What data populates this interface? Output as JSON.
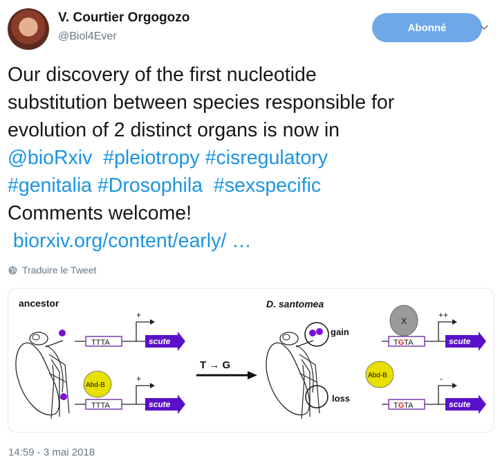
{
  "author": {
    "display_name": "V. Courtier Orgogozo",
    "handle": "@Biol4Ever"
  },
  "follow_button": {
    "label": "Abonné"
  },
  "tweet": {
    "line1": "Our discovery of the first nucleotide",
    "line2": "substitution between species responsible for",
    "line3": "evolution of 2 distinct organs is now in",
    "mention": "@bioRxiv",
    "hashtag_pleiotropy": "#pleiotropy",
    "hashtag_cisregulatory": "#cisregulatory",
    "hashtag_genitalia": "#genitalia",
    "hashtag_drosophila": "#Drosophila",
    "hashtag_sexspecific": "#sexspecific",
    "line6": "Comments welcome!",
    "link": "biorxiv.org/content/early/ …"
  },
  "translate_label": "Traduire le Tweet",
  "figure": {
    "left_title": "ancestor",
    "right_title": "D. santomea",
    "arrow_label": "T → G",
    "gene": "scute",
    "ttta": "TTTA",
    "tgta_prefix": "T",
    "tgta_g": "G",
    "tgta_suffix": "TA",
    "plus": "+",
    "plusplus": "++",
    "minus": "-",
    "abdb": "Abd-B",
    "x_factor": "X",
    "gain": "gain",
    "loss": "loss",
    "colors": {
      "scute_arrow": "#5a0fc8",
      "box_border": "#7a3ab0",
      "abdb_fill": "#e8e000",
      "x_fill": "#9a9a9a",
      "red_g": "#e02020",
      "dot": "#7a10d8"
    }
  },
  "timestamp": "14:59 - 3 mai 2018"
}
